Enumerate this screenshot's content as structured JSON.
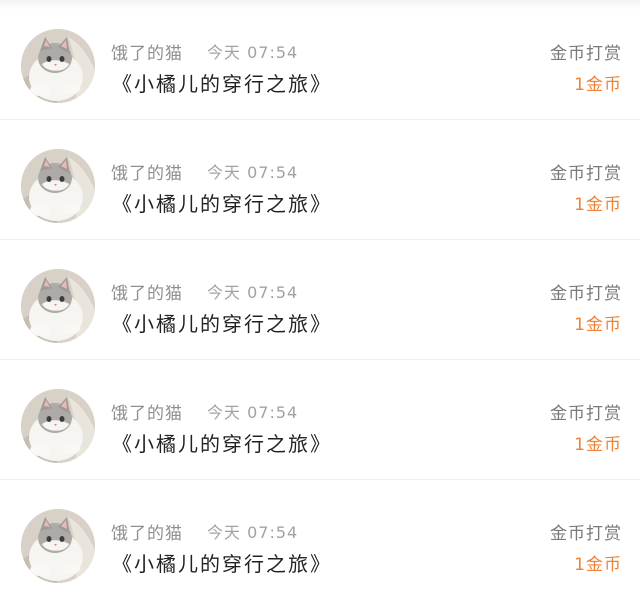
{
  "colors": {
    "background": "#ffffff",
    "name_text": "#8f8f8f",
    "time_text": "#a2a2a2",
    "title_text": "#222222",
    "gift_label_text": "#7a7a7a",
    "gift_amount_text": "#f08132",
    "divider": "#efefef"
  },
  "items": [
    {
      "avatar": "cat-avatar-icon",
      "username": "饿了的猫",
      "time": "今天 07:54",
      "title": "《小橘儿的穿行之旅》",
      "gift_label": "金币打赏",
      "gift_amount": "1金币"
    },
    {
      "avatar": "cat-avatar-icon",
      "username": "饿了的猫",
      "time": "今天 07:54",
      "title": "《小橘儿的穿行之旅》",
      "gift_label": "金币打赏",
      "gift_amount": "1金币"
    },
    {
      "avatar": "cat-avatar-icon",
      "username": "饿了的猫",
      "time": "今天 07:54",
      "title": "《小橘儿的穿行之旅》",
      "gift_label": "金币打赏",
      "gift_amount": "1金币"
    },
    {
      "avatar": "cat-avatar-icon",
      "username": "饿了的猫",
      "time": "今天 07:54",
      "title": "《小橘儿的穿行之旅》",
      "gift_label": "金币打赏",
      "gift_amount": "1金币"
    },
    {
      "avatar": "cat-avatar-icon",
      "username": "饿了的猫",
      "time": "今天 07:54",
      "title": "《小橘儿的穿行之旅》",
      "gift_label": "金币打赏",
      "gift_amount": "1金币"
    }
  ]
}
